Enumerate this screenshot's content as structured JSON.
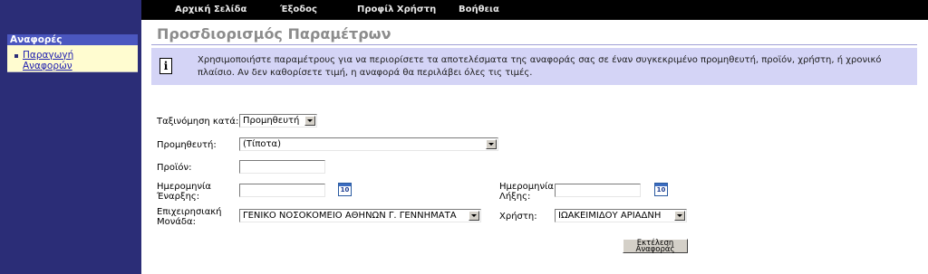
{
  "topnav": {
    "items": [
      "Αρχική Σελίδα",
      "Έξοδος",
      "Προφίλ Χρήστη",
      "Βοήθεια"
    ]
  },
  "sidebar": {
    "header": "Αναφορές",
    "items": [
      {
        "label_line1": "Παραγωγή",
        "label_line2": "Αναφορών"
      }
    ]
  },
  "page": {
    "title": "Προσδιορισμός Παραμέτρων"
  },
  "info": {
    "icon": "info-icon",
    "text_line1": "Χρησιμοποιήστε παραμέτρους για να περιορίσετε τα αποτελέσματα της αναφοράς σας σε έναν συγκεκριμένο προμηθευτή, προϊόν, χρήστη, ή χρονικό",
    "text_line2": "πλαίσιο. Αν δεν καθορίσετε τιμή, η αναφορά θα περιλάβει όλες τις τιμές."
  },
  "form": {
    "sort_by": {
      "label": "Ταξινόμηση κατά:",
      "value": "Προμηθευτή"
    },
    "supplier": {
      "label": "Προμηθευτή:",
      "value": "(Τίποτα)"
    },
    "product": {
      "label": "Προϊόν:",
      "value": ""
    },
    "start_date": {
      "label_line1": "Ημερομηνία",
      "label_line2": "Έναρξης:",
      "value": ""
    },
    "end_date": {
      "label_line1": "Ημερομηνία",
      "label_line2": "Λήξης:",
      "value": ""
    },
    "calendar_icon_text": "10",
    "business_unit": {
      "label_line1": "Επιχειρησιακή",
      "label_line2": "Μονάδα:",
      "value": "ΓΕΝΙΚΟ ΝΟΣΟΚΟΜΕΙΟ ΑΘΗΝΩΝ Γ. ΓΕΝΝΗΜΑΤΑ"
    },
    "user": {
      "label": "Χρήστη:",
      "value": "ΙΩΑΚΕΙΜΙΔΟΥ ΑΡΙΑΔΝΗ"
    },
    "run_button": {
      "label_line1": "Εκτέλεση",
      "label_line2": "Αναφοράς"
    }
  },
  "colors": {
    "sidebar_bg": "#2b2d77",
    "topbar_bg": "#000000",
    "info_bg": "#d4d4f6",
    "sidebar_item_bg": "#fffcd0",
    "sidebar_header_bg": "#4b57c0"
  }
}
